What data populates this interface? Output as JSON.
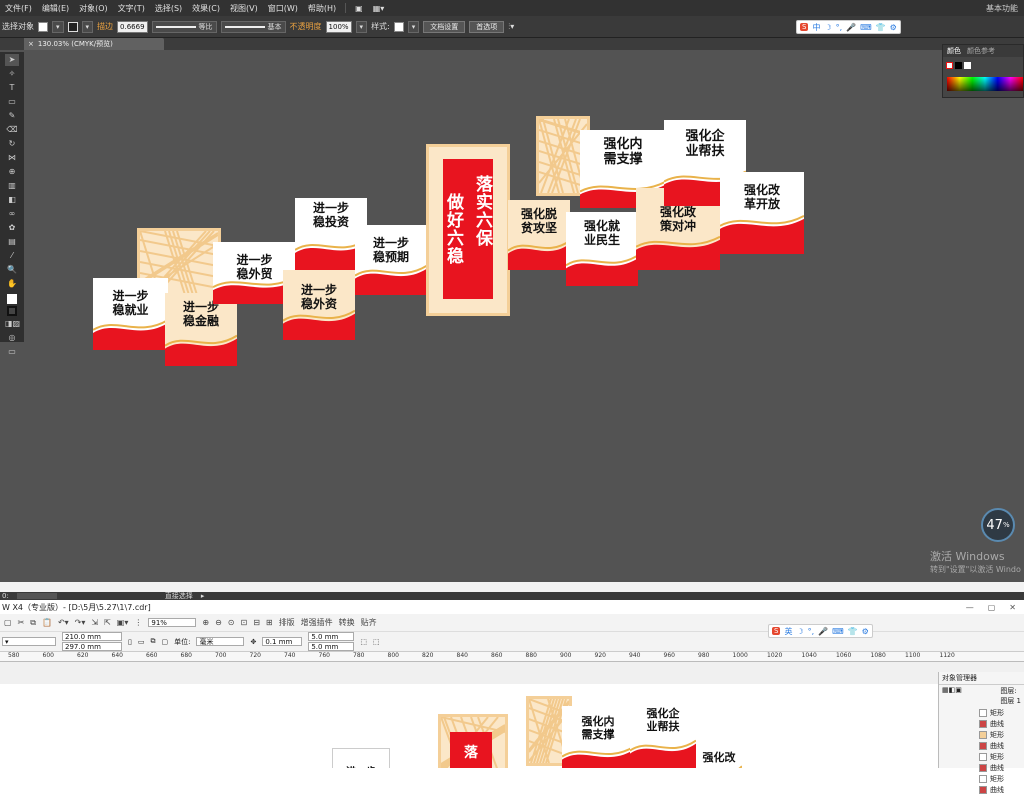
{
  "ai": {
    "menu": [
      "文件(F)",
      "编辑(E)",
      "对象(O)",
      "文字(T)",
      "选择(S)",
      "效果(C)",
      "视图(V)",
      "窗口(W)",
      "帮助(H)"
    ],
    "workspace": "基本功能",
    "control": {
      "selection_label": "选择对象",
      "stroke_label": "描边",
      "stroke_value": "0.6669",
      "stroke_profile": "等比",
      "brush": "基本",
      "opacity_label": "不透明度",
      "opacity_value": "100%",
      "style_label": "样式:",
      "doc_setup": "文档设置",
      "preferences": "首选项"
    },
    "tab_title": "130.03% (CMYK/预览)",
    "color_panel": {
      "tab1": "颜色",
      "tab2": "颜色参考"
    },
    "zoom_percent": "47",
    "zoom_unit": "%",
    "activate_title": "激活 Windows",
    "activate_sub": "转到\"设置\"以激活 Windo",
    "status": {
      "zoom": "0:",
      "tool": "直接选择"
    }
  },
  "artwork": {
    "center_line1": "落实六保",
    "center_line2": "做好六稳",
    "left_panels": [
      "进一步\n稳就业",
      "进一步\n稳金融",
      "进一步\n稳外贸",
      "进一步\n稳外资",
      "进一步\n稳投资",
      "进一步\n稳预期"
    ],
    "right_panels": [
      "强化脱\n贫攻坚",
      "强化就\n业民生",
      "强化内\n需支撑",
      "强化政\n策对冲",
      "强化企\n业帮扶",
      "强化改\n革开放"
    ]
  },
  "cdr": {
    "title": "W X4（专业版）- [D:\\5月\\5.27\\1\\7.cdr]",
    "toolbar": {
      "zoom": "91%",
      "arrange": "排版",
      "enhance": "增强插件",
      "convert": "转换",
      "paste": "贴齐"
    },
    "width": "210.0 mm",
    "height": "297.0 mm",
    "unit_label": "单位:",
    "unit": "毫米",
    "nudge": "0.1 mm",
    "dup_x": "5.0 mm",
    "dup_y": "5.0 mm",
    "ruler": [
      "580",
      "600",
      "620",
      "640",
      "660",
      "680",
      "700",
      "720",
      "740",
      "760",
      "780",
      "800",
      "820",
      "840",
      "860",
      "880",
      "900",
      "920",
      "940",
      "960",
      "980",
      "1000",
      "1020",
      "1040",
      "1060",
      "1080",
      "1100",
      "1120"
    ],
    "obj_manager": {
      "title": "对象管理器",
      "layer": "图层:",
      "layer_name": "图层 1",
      "items": [
        "矩形",
        "曲线",
        "矩形",
        "曲线",
        "矩形",
        "曲线",
        "矩形",
        "曲线"
      ]
    },
    "preview_labels": [
      "落",
      "强化内\n需支撑",
      "强化企\n业帮扶",
      "强化改"
    ],
    "preview_left": "进一步"
  },
  "colors": {
    "red": "#e8141f",
    "cream": "#fbe7c8",
    "gold": "#e9b24a",
    "canvas": "#535353"
  }
}
